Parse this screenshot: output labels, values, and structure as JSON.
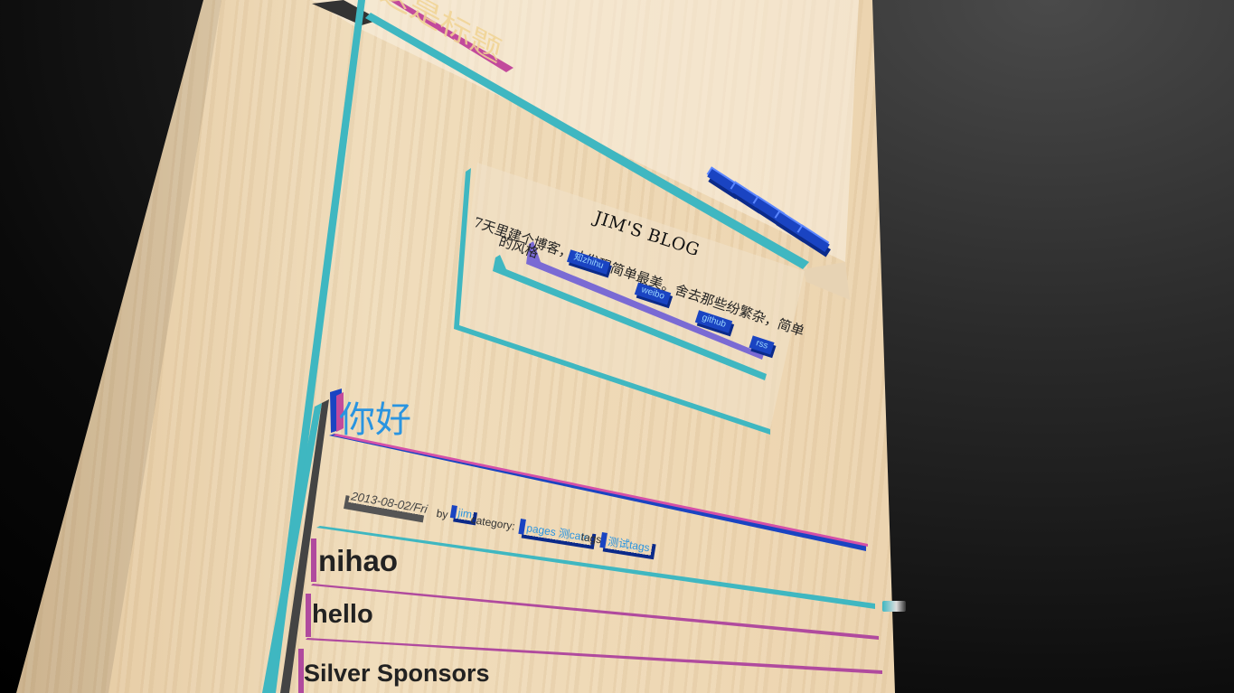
{
  "site": {
    "title": "这是标题",
    "blog_name": "JIM'S BLOG",
    "description_line1": "7天里建个博客，才发现简单最美。舍去那些纷繁杂，简单",
    "description_line2": "的风格"
  },
  "social_links": [
    {
      "label": "知zhihu"
    },
    {
      "label": "weibo"
    },
    {
      "label": "github"
    },
    {
      "label": "rss"
    }
  ],
  "nav": {
    "tabs": [
      "",
      "",
      "",
      "",
      ""
    ]
  },
  "post": {
    "title": "你好",
    "date": "2013-08-02/Fri",
    "by_label": "by",
    "author": "jim",
    "category_label": "category:",
    "category": "pages 测cate",
    "tags_label": "tags:",
    "tags": "测试tags"
  },
  "list_items": [
    {
      "label": "nihao"
    },
    {
      "label": "hello"
    },
    {
      "label": "Silver Sponsors"
    }
  ],
  "colors": {
    "accent_teal": "#3fb7c1",
    "accent_blue": "#1a44c2",
    "accent_pink": "#c24a9c",
    "link_blue": "#2a94e0"
  }
}
